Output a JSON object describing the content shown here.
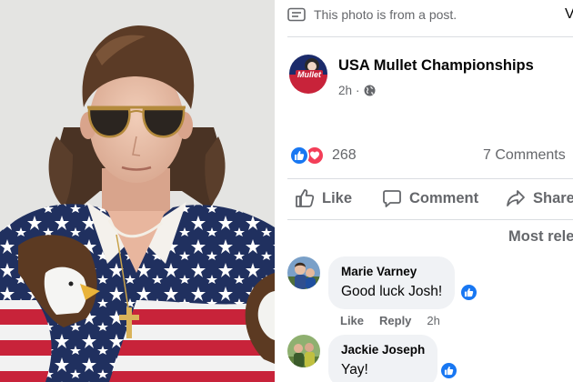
{
  "post": {
    "notice": "This photo is from a post.",
    "top_right_glyph": "V",
    "page_name": "USA Mullet Championships",
    "time": "2h",
    "logo_text": "Mullet",
    "reaction_count": "268",
    "comments_count": "7 Comments"
  },
  "actions": {
    "like": "Like",
    "comment": "Comment",
    "share": "Share"
  },
  "sort": {
    "label": "Most relevant"
  },
  "comments": [
    {
      "name": "Marie Varney",
      "text": "Good luck Josh!",
      "like": "Like",
      "reply": "Reply",
      "time": "2h"
    },
    {
      "name": "Jackie Joseph",
      "text": "Yay!"
    }
  ],
  "colors": {
    "facebook_blue": "#1877f2",
    "love_red": "#f33e58",
    "secondary_text": "#65676b",
    "bubble_bg": "#f0f2f5",
    "divider": "#dadde1"
  },
  "icons": [
    "post-notice-icon",
    "globe-icon",
    "like-reaction-icon",
    "love-reaction-icon",
    "thumbs-up-icon",
    "comment-icon",
    "share-icon",
    "comment-like-badge-icon"
  ]
}
